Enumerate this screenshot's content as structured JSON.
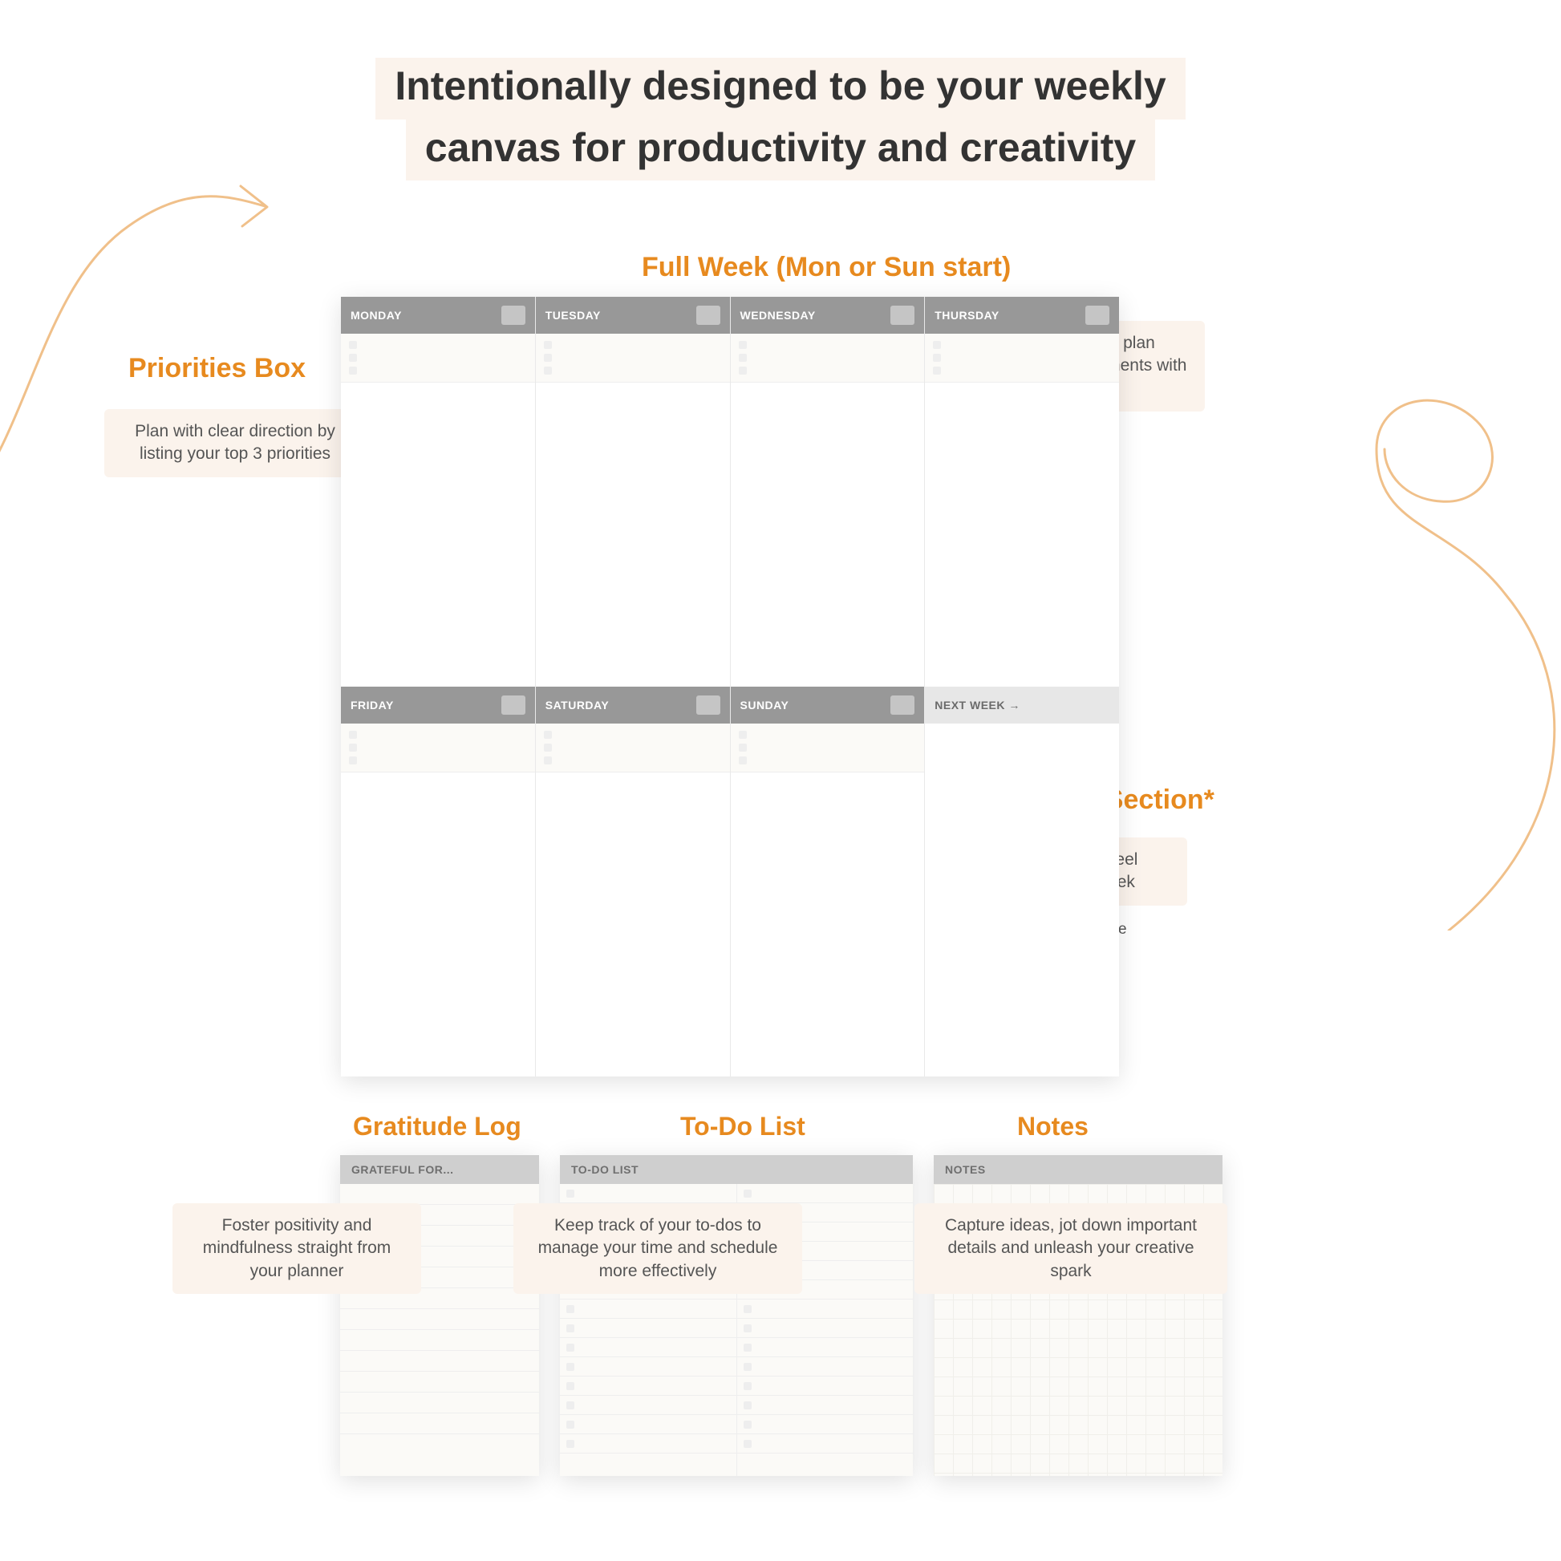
{
  "headline": {
    "line1": "Intentionally designed to be your weekly",
    "line2": "canvas for productivity and creativity"
  },
  "sections": {
    "full_week": "Full Week (Mon or Sun start)",
    "priorities": "Priorities Box",
    "next_week": "‘Next Week’ Section*",
    "gratitude": "Gratitude Log",
    "todo": "To-Do List",
    "notes": "Notes"
  },
  "callouts": {
    "priorities": "Plan with clear direction by listing your top 3 priorities",
    "full_week": "Embrace flexibility and plan according to your commitments with a full week",
    "next_week": "Stay ahead and always feel prepared for the next week",
    "gratitude": "Foster positivity and mindfulness straight from your planner",
    "todo": "Keep track of your to-dos to manage your time and schedule more effectively",
    "notes": "Capture ideas, jot down important details and unleash your creative spark"
  },
  "asterisk_note": "Only available in ‘V-Box’ Template",
  "asterisk_mark": "*",
  "planner": {
    "row1": [
      "MONDAY",
      "TUESDAY",
      "WEDNESDAY",
      "THURSDAY"
    ],
    "row2": [
      "FRIDAY",
      "SATURDAY",
      "SUNDAY"
    ],
    "next_week_label": "NEXT WEEK →"
  },
  "cards": {
    "grateful_header": "GRATEFUL FOR...",
    "todo_header": "TO-DO LIST",
    "notes_header": "NOTES"
  }
}
